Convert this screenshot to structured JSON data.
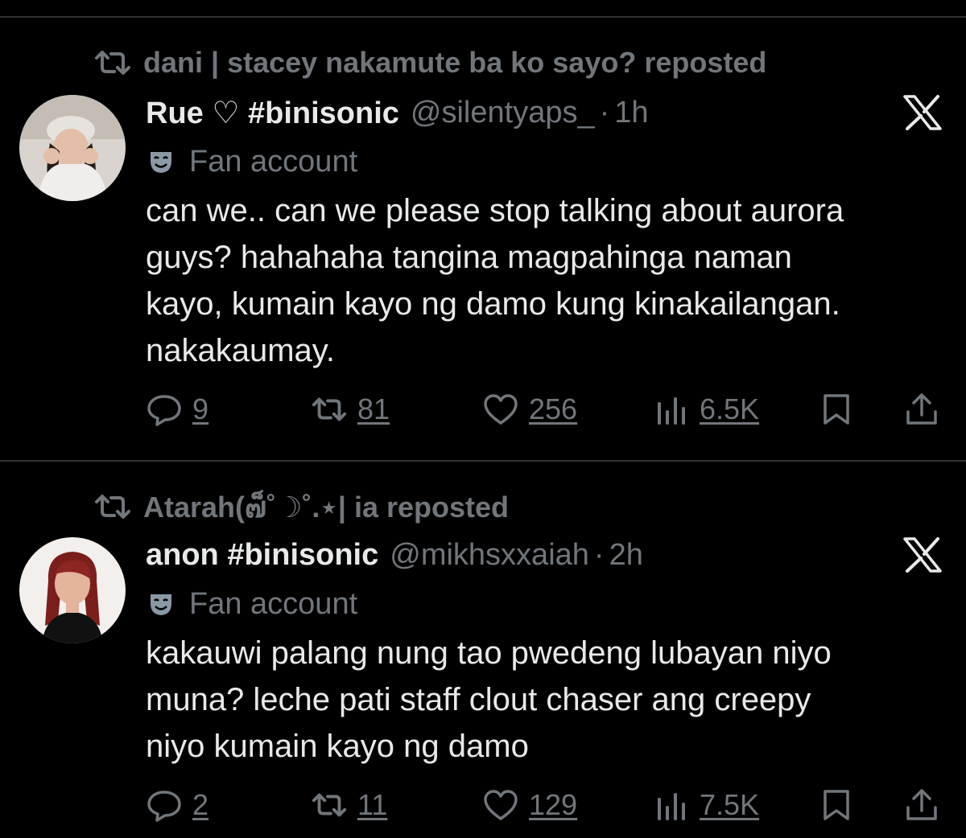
{
  "tweets": [
    {
      "repost_text": "dani | stacey nakamute ba ko sayo? reposted",
      "name": "Rue ♡ #binisonic",
      "handle": "@silentyaps_",
      "separator": "·",
      "time": "1h",
      "label": "Fan account",
      "body_lines": [
        "can we.. can we please stop talking about aurora",
        "guys? hahahaha tangina magpahinga naman",
        "kayo, kumain kayo ng damo kung kinakailangan.",
        "nakakaumay."
      ],
      "replies": "9",
      "reposts": "81",
      "likes": "256",
      "views": "6.5K"
    },
    {
      "repost_text": "Atarah(๗็˚☽˚.⋆| ia reposted",
      "name": "anon #binisonic",
      "handle": "@mikhsxxaiah",
      "separator": "·",
      "time": "2h",
      "label": "Fan account",
      "body_lines": [
        "kakauwi palang nung tao pwedeng lubayan niyo",
        "muna? leche pati staff clout chaser ang creepy",
        "niyo kumain kayo ng damo"
      ],
      "replies": "2",
      "reposts": "11",
      "likes": "129",
      "views": "7.5K"
    }
  ],
  "colors": {
    "background": "#000000",
    "text": "#e7e9ea",
    "secondary": "#71767b",
    "divider": "#2f3336"
  },
  "icons": [
    "repost-icon",
    "x-logo-icon",
    "mask-icon",
    "reply-icon",
    "like-icon",
    "views-icon",
    "bookmark-icon",
    "share-icon"
  ]
}
